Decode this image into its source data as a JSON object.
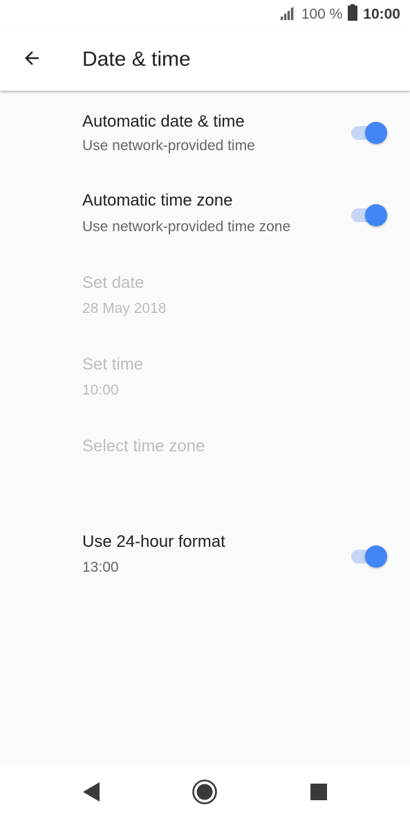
{
  "status_bar": {
    "battery_text": "100 %",
    "time": "10:00",
    "icons": [
      "signal-icon",
      "battery-icon"
    ]
  },
  "app_bar": {
    "title": "Date & time",
    "back_icon": "arrow-back-icon"
  },
  "settings": [
    {
      "title": "Automatic date & time",
      "summary": "Use network-provided time",
      "toggle": true,
      "enabled": true
    },
    {
      "title": "Automatic time zone",
      "summary": "Use network-provided time zone",
      "toggle": true,
      "enabled": true
    },
    {
      "title": "Set date",
      "summary": "28 May 2018",
      "enabled": false
    },
    {
      "title": "Set time",
      "summary": "10:00",
      "enabled": false
    },
    {
      "title": "Select time zone",
      "summary": "",
      "enabled": false
    },
    {
      "title": "Use 24-hour format",
      "summary": "13:00",
      "toggle": true,
      "enabled": true
    }
  ],
  "nav_bar": {
    "icons": [
      "back-triangle-icon",
      "home-circle-icon",
      "recents-square-icon"
    ]
  },
  "colors": {
    "accent": "#4285f4",
    "accent_track": "#c6d7f5",
    "background": "#fafafa",
    "disabled_text": "#bdbdbd"
  }
}
